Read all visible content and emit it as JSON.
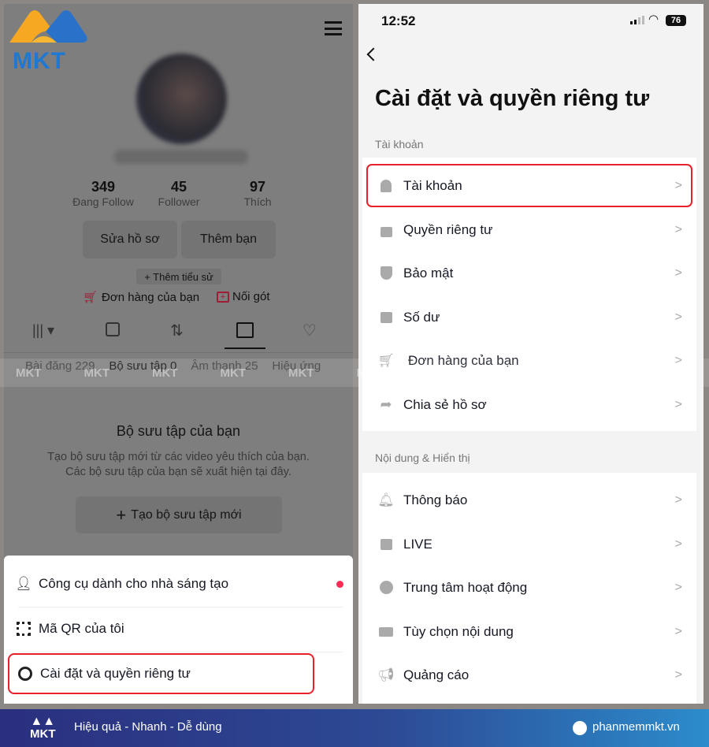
{
  "brand": {
    "logo_text": "MKT",
    "tagline": "Hiệu quả - Nhanh - Dễ dùng",
    "website": "phanmemmkt.vn",
    "watermark": "MKT"
  },
  "profile": {
    "stats": [
      {
        "value": "349",
        "label": "Đang Follow"
      },
      {
        "value": "45",
        "label": "Follower"
      },
      {
        "value": "97",
        "label": "Thích"
      }
    ],
    "edit_button": "Sửa hồ sơ",
    "add_friend_button": "Thêm bạn",
    "add_bio": "+ Thêm tiểu sử",
    "orders_link": "Đơn hàng của bạn",
    "connect_link": "Nối gót",
    "subtabs": [
      "Bài đăng 229",
      "Bộ sưu tập 0",
      "Âm thanh 25",
      "Hiệu ứng"
    ],
    "collection_title": "Bộ sưu tập của bạn",
    "collection_desc_1": "Tạo bộ sưu tập mới từ các video yêu thích của bạn.",
    "collection_desc_2": "Các bộ sưu tập của bạn sẽ xuất hiện tại đây.",
    "create_collection_button": "Tạo bộ sưu tập mới"
  },
  "sheet": {
    "items": [
      {
        "label": "Công cụ dành cho nhà sáng tạo",
        "icon": "creator-tools-icon"
      },
      {
        "label": "Mã QR của tôi",
        "icon": "qr-code-icon"
      },
      {
        "label": "Cài đặt và quyền riêng tư",
        "icon": "settings-gear-icon",
        "highlighted": true
      }
    ]
  },
  "settings": {
    "status_time": "12:52",
    "battery": "76",
    "title": "Cài đặt và quyền riêng tư",
    "sections": [
      {
        "label": "Tài khoản",
        "items": [
          {
            "label": "Tài khoản",
            "icon": "person-icon",
            "highlighted": true
          },
          {
            "label": "Quyền riêng tư",
            "icon": "lock-icon"
          },
          {
            "label": "Bảo mật",
            "icon": "shield-icon"
          },
          {
            "label": "Số dư",
            "icon": "wallet-icon"
          },
          {
            "label": "Đơn hàng của bạn",
            "icon": "cart-icon"
          },
          {
            "label": "Chia sẻ hồ sơ",
            "icon": "share-icon"
          }
        ]
      },
      {
        "label": "Nội dung & Hiển thị",
        "items": [
          {
            "label": "Thông báo",
            "icon": "bell-icon"
          },
          {
            "label": "LIVE",
            "icon": "live-icon"
          },
          {
            "label": "Trung tâm hoạt động",
            "icon": "clock-icon"
          },
          {
            "label": "Tùy chọn nội dung",
            "icon": "video-icon"
          },
          {
            "label": "Quảng cáo",
            "icon": "megaphone-icon"
          }
        ]
      }
    ]
  },
  "colors": {
    "highlight": "#e8202a",
    "accent": "#fe2c55",
    "banner_start": "#2a2f7e",
    "banner_end": "#2c8ccc"
  }
}
